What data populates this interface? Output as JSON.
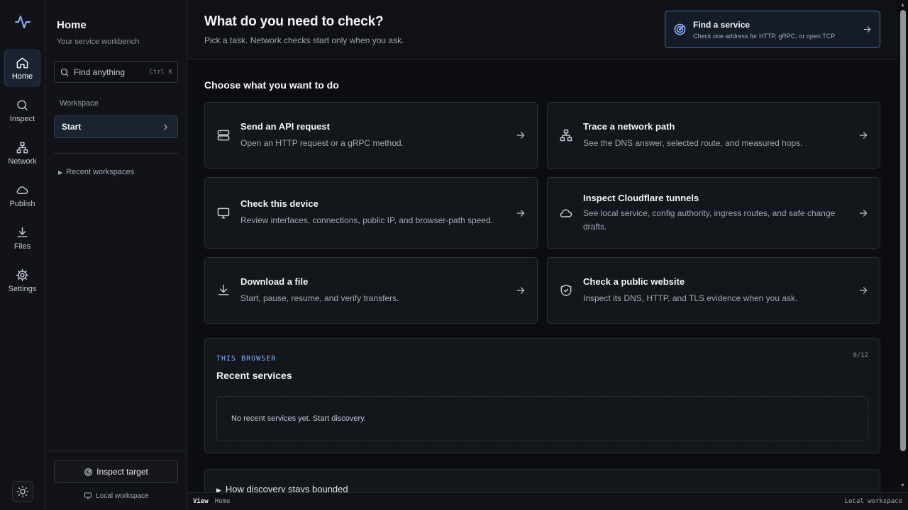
{
  "rail": {
    "items": [
      {
        "label": "Home",
        "icon": "home-icon",
        "active": true
      },
      {
        "label": "Inspect",
        "icon": "search-icon"
      },
      {
        "label": "Network",
        "icon": "network-icon"
      },
      {
        "label": "Publish",
        "icon": "cloud-icon"
      },
      {
        "label": "Files",
        "icon": "download-icon"
      },
      {
        "label": "Settings",
        "icon": "gear-icon"
      }
    ],
    "logo_icon": "pulse-icon",
    "theme_icon": "sun-icon"
  },
  "panel": {
    "title": "Home",
    "subtitle": "Your service workbench",
    "search": {
      "placeholder": "Find anything",
      "shortcut": "Ctrl K"
    },
    "section_label": "Workspace",
    "start_label": "Start",
    "recent_workspaces": "Recent workspaces",
    "inspect_target": "Inspect target",
    "local_workspace": "Local workspace"
  },
  "header": {
    "title": "What do you need to check?",
    "subtitle": "Pick a task. Network checks start only when you ask.",
    "find_service": {
      "title": "Find a service",
      "description": "Check one address for HTTP, gRPC, or open TCP"
    }
  },
  "tasks": {
    "heading": "Choose what you want to do",
    "cards": [
      {
        "title": "Send an API request",
        "description": "Open an HTTP request or a gRPC method.",
        "icon": "server-icon"
      },
      {
        "title": "Trace a network path",
        "description": "See the DNS answer, selected route, and measured hops.",
        "icon": "network-icon"
      },
      {
        "title": "Check this device",
        "description": "Review interfaces, connections, public IP, and browser-path speed.",
        "icon": "monitor-icon"
      },
      {
        "title": "Inspect Cloudflare tunnels",
        "description": "See local service, config authority, ingress routes, and safe change drafts.",
        "icon": "cloud-icon"
      },
      {
        "title": "Download a file",
        "description": "Start, pause, resume, and verify transfers.",
        "icon": "download-icon"
      },
      {
        "title": "Check a public website",
        "description": "Inspect its DNS, HTTP, and TLS evidence when you ask.",
        "icon": "shield-icon"
      }
    ]
  },
  "recent": {
    "kicker": "THIS BROWSER",
    "count": "0/12",
    "title": "Recent services",
    "empty": "No recent services yet. Start discovery."
  },
  "bounded": {
    "label": "How discovery stays bounded"
  },
  "statusbar": {
    "view": "View",
    "page": "Home",
    "workspace": "Local workspace"
  },
  "colors": {
    "accent": "#8ab4ff",
    "active_bg": "#1b2230",
    "background": "#0c0d10"
  }
}
